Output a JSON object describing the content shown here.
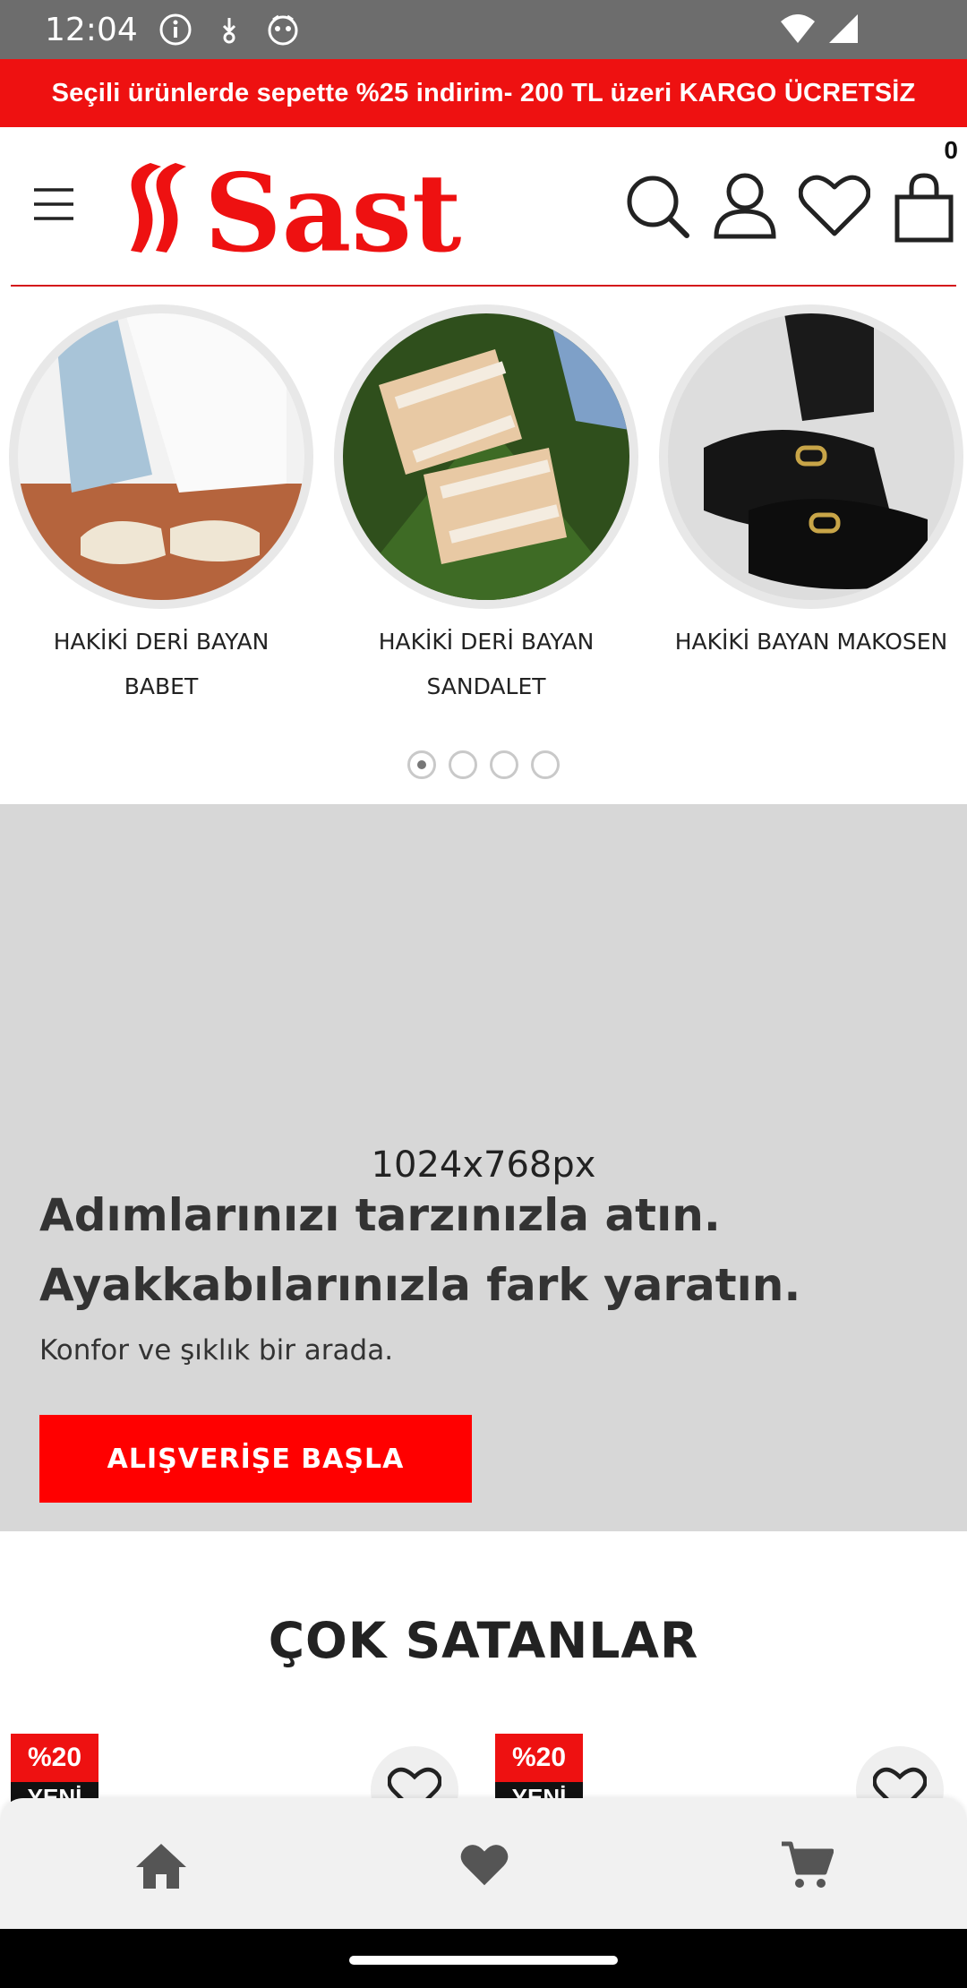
{
  "status_bar": {
    "time": "12:04",
    "icons": [
      "info-icon",
      "download-icon",
      "face-icon",
      "wifi-icon",
      "signal-icon"
    ]
  },
  "promo": {
    "text": "Seçili ürünlerde sepette %25 indirim- 200 TL üzeri KARGO ÜCRETSİZ"
  },
  "header": {
    "logo_text": "Sast",
    "cart_count": "0",
    "icons": [
      "menu-icon",
      "search-icon",
      "user-icon",
      "heart-icon",
      "bag-icon"
    ]
  },
  "categories": [
    {
      "label_line1": "HAKİKİ DERİ BAYAN",
      "label_line2": "BABET"
    },
    {
      "label_line1": "HAKİKİ DERİ BAYAN",
      "label_line2": "SANDALET"
    },
    {
      "label_line1": "HAKİKİ BAYAN MAKOSEN",
      "label_line2": ""
    }
  ],
  "carousel": {
    "pages": 4,
    "active": 1
  },
  "hero": {
    "placeholder": "1024x768px",
    "title_line1": "Adımlarınızı tarzınızla atın.",
    "title_line2": "Ayakkabılarınızla fark yaratın.",
    "subtitle": "Konfor ve şıklık bir arada.",
    "cta": "ALIŞVERİŞE BAŞLA"
  },
  "best_sellers": {
    "title": "ÇOK SATANLAR",
    "products": [
      {
        "discount": "%20",
        "new_label": "YENİ"
      },
      {
        "discount": "%20",
        "new_label": "YENİ"
      }
    ]
  },
  "bottom_nav": {
    "icons": [
      "home-icon",
      "heart-icon",
      "cart-icon"
    ]
  },
  "colors": {
    "brand_red": "#ee1111",
    "status_bar": "#6d6d6d",
    "hero_bg": "#d7d7d7"
  }
}
